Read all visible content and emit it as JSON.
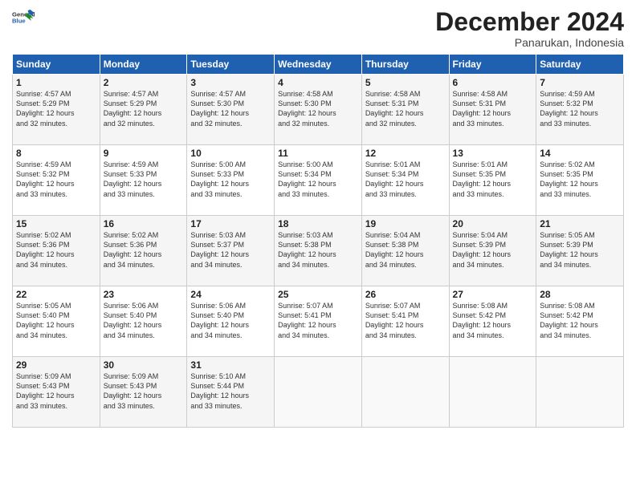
{
  "header": {
    "logo_line1": "General",
    "logo_line2": "Blue",
    "title": "December 2024",
    "subtitle": "Panarukan, Indonesia"
  },
  "columns": [
    "Sunday",
    "Monday",
    "Tuesday",
    "Wednesday",
    "Thursday",
    "Friday",
    "Saturday"
  ],
  "weeks": [
    [
      {
        "day": "1",
        "info": "Sunrise: 4:57 AM\nSunset: 5:29 PM\nDaylight: 12 hours\nand 32 minutes."
      },
      {
        "day": "2",
        "info": "Sunrise: 4:57 AM\nSunset: 5:29 PM\nDaylight: 12 hours\nand 32 minutes."
      },
      {
        "day": "3",
        "info": "Sunrise: 4:57 AM\nSunset: 5:30 PM\nDaylight: 12 hours\nand 32 minutes."
      },
      {
        "day": "4",
        "info": "Sunrise: 4:58 AM\nSunset: 5:30 PM\nDaylight: 12 hours\nand 32 minutes."
      },
      {
        "day": "5",
        "info": "Sunrise: 4:58 AM\nSunset: 5:31 PM\nDaylight: 12 hours\nand 32 minutes."
      },
      {
        "day": "6",
        "info": "Sunrise: 4:58 AM\nSunset: 5:31 PM\nDaylight: 12 hours\nand 33 minutes."
      },
      {
        "day": "7",
        "info": "Sunrise: 4:59 AM\nSunset: 5:32 PM\nDaylight: 12 hours\nand 33 minutes."
      }
    ],
    [
      {
        "day": "8",
        "info": "Sunrise: 4:59 AM\nSunset: 5:32 PM\nDaylight: 12 hours\nand 33 minutes."
      },
      {
        "day": "9",
        "info": "Sunrise: 4:59 AM\nSunset: 5:33 PM\nDaylight: 12 hours\nand 33 minutes."
      },
      {
        "day": "10",
        "info": "Sunrise: 5:00 AM\nSunset: 5:33 PM\nDaylight: 12 hours\nand 33 minutes."
      },
      {
        "day": "11",
        "info": "Sunrise: 5:00 AM\nSunset: 5:34 PM\nDaylight: 12 hours\nand 33 minutes."
      },
      {
        "day": "12",
        "info": "Sunrise: 5:01 AM\nSunset: 5:34 PM\nDaylight: 12 hours\nand 33 minutes."
      },
      {
        "day": "13",
        "info": "Sunrise: 5:01 AM\nSunset: 5:35 PM\nDaylight: 12 hours\nand 33 minutes."
      },
      {
        "day": "14",
        "info": "Sunrise: 5:02 AM\nSunset: 5:35 PM\nDaylight: 12 hours\nand 33 minutes."
      }
    ],
    [
      {
        "day": "15",
        "info": "Sunrise: 5:02 AM\nSunset: 5:36 PM\nDaylight: 12 hours\nand 34 minutes."
      },
      {
        "day": "16",
        "info": "Sunrise: 5:02 AM\nSunset: 5:36 PM\nDaylight: 12 hours\nand 34 minutes."
      },
      {
        "day": "17",
        "info": "Sunrise: 5:03 AM\nSunset: 5:37 PM\nDaylight: 12 hours\nand 34 minutes."
      },
      {
        "day": "18",
        "info": "Sunrise: 5:03 AM\nSunset: 5:38 PM\nDaylight: 12 hours\nand 34 minutes."
      },
      {
        "day": "19",
        "info": "Sunrise: 5:04 AM\nSunset: 5:38 PM\nDaylight: 12 hours\nand 34 minutes."
      },
      {
        "day": "20",
        "info": "Sunrise: 5:04 AM\nSunset: 5:39 PM\nDaylight: 12 hours\nand 34 minutes."
      },
      {
        "day": "21",
        "info": "Sunrise: 5:05 AM\nSunset: 5:39 PM\nDaylight: 12 hours\nand 34 minutes."
      }
    ],
    [
      {
        "day": "22",
        "info": "Sunrise: 5:05 AM\nSunset: 5:40 PM\nDaylight: 12 hours\nand 34 minutes."
      },
      {
        "day": "23",
        "info": "Sunrise: 5:06 AM\nSunset: 5:40 PM\nDaylight: 12 hours\nand 34 minutes."
      },
      {
        "day": "24",
        "info": "Sunrise: 5:06 AM\nSunset: 5:40 PM\nDaylight: 12 hours\nand 34 minutes."
      },
      {
        "day": "25",
        "info": "Sunrise: 5:07 AM\nSunset: 5:41 PM\nDaylight: 12 hours\nand 34 minutes."
      },
      {
        "day": "26",
        "info": "Sunrise: 5:07 AM\nSunset: 5:41 PM\nDaylight: 12 hours\nand 34 minutes."
      },
      {
        "day": "27",
        "info": "Sunrise: 5:08 AM\nSunset: 5:42 PM\nDaylight: 12 hours\nand 34 minutes."
      },
      {
        "day": "28",
        "info": "Sunrise: 5:08 AM\nSunset: 5:42 PM\nDaylight: 12 hours\nand 34 minutes."
      }
    ],
    [
      {
        "day": "29",
        "info": "Sunrise: 5:09 AM\nSunset: 5:43 PM\nDaylight: 12 hours\nand 33 minutes."
      },
      {
        "day": "30",
        "info": "Sunrise: 5:09 AM\nSunset: 5:43 PM\nDaylight: 12 hours\nand 33 minutes."
      },
      {
        "day": "31",
        "info": "Sunrise: 5:10 AM\nSunset: 5:44 PM\nDaylight: 12 hours\nand 33 minutes."
      },
      {
        "day": "",
        "info": ""
      },
      {
        "day": "",
        "info": ""
      },
      {
        "day": "",
        "info": ""
      },
      {
        "day": "",
        "info": ""
      }
    ]
  ]
}
